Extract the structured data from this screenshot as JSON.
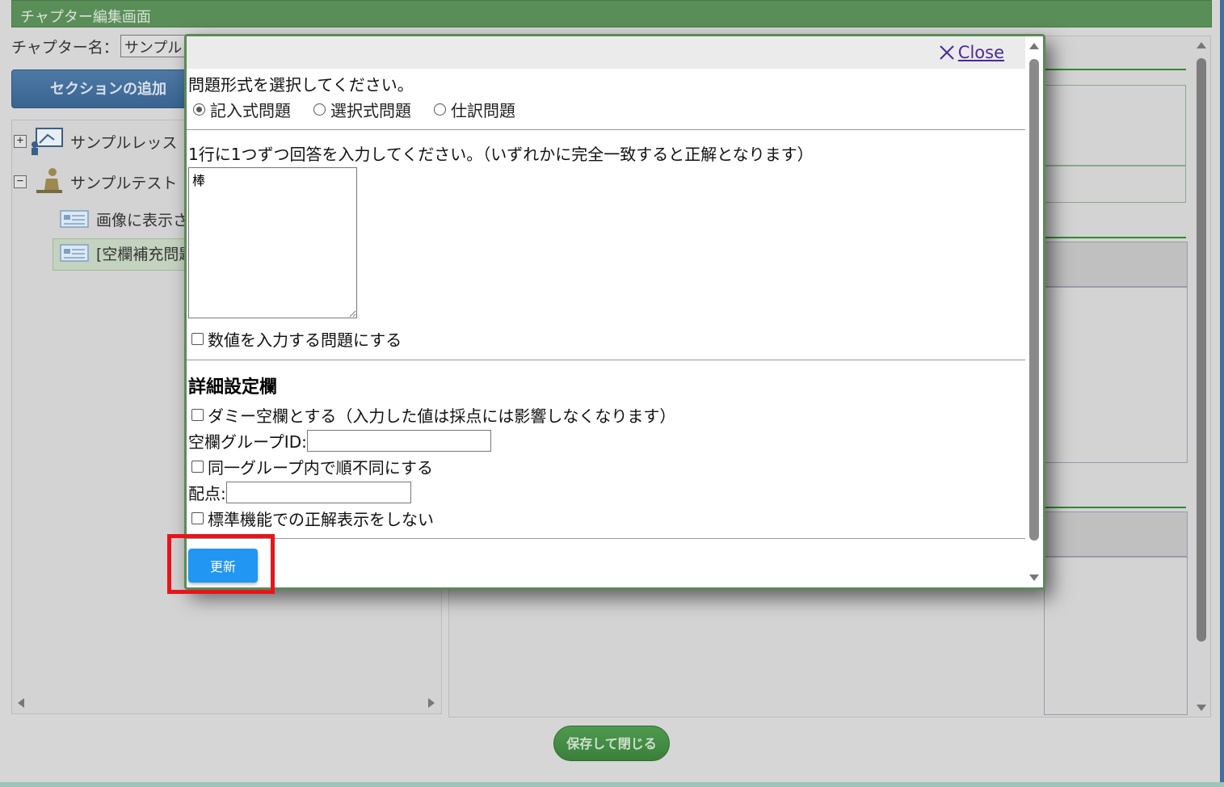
{
  "app": {
    "title": "チャプター編集画面",
    "chapter_label": "チャプター名：",
    "chapter_value": "サンプル",
    "add_section_label": "セクションの追加",
    "save_close_label": "保存して閉じる"
  },
  "tree": {
    "items": [
      {
        "toggle": "+",
        "label": "サンプルレッス"
      },
      {
        "toggle": "−",
        "label": "サンプルテスト"
      },
      {
        "label": "画像に表示さ"
      },
      {
        "label": "[空欄補充問題"
      }
    ]
  },
  "modal": {
    "close_label": "Close",
    "question_type_prompt": "問題形式を選択してください。",
    "question_types": [
      {
        "label": "記入式問題",
        "selected": true
      },
      {
        "label": "選択式問題",
        "selected": false
      },
      {
        "label": "仕訳問題",
        "selected": false
      }
    ],
    "answer_prompt": "1行に1つずつ回答を入力してください。（いずれかに完全一致すると正解となります）",
    "answer_value": "棒",
    "numeric_checkbox_label": "数値を入力する問題にする",
    "details_title": "詳細設定欄",
    "dummy_checkbox_label": "ダミー空欄とする（入力した値は採点には影響しなくなります）",
    "group_id_label": "空欄グループID:",
    "group_id_value": "",
    "unordered_checkbox_label": "同一グループ内で順不同にする",
    "points_label": "配点:",
    "points_value": "",
    "hide_answer_checkbox_label": "標準機能での正解表示をしない",
    "update_label": "更新"
  },
  "colors": {
    "accent_green": "#5a8e58",
    "update_blue": "#2196f3",
    "highlight_red": "#e8141c",
    "close_link": "#4a2a9a"
  }
}
